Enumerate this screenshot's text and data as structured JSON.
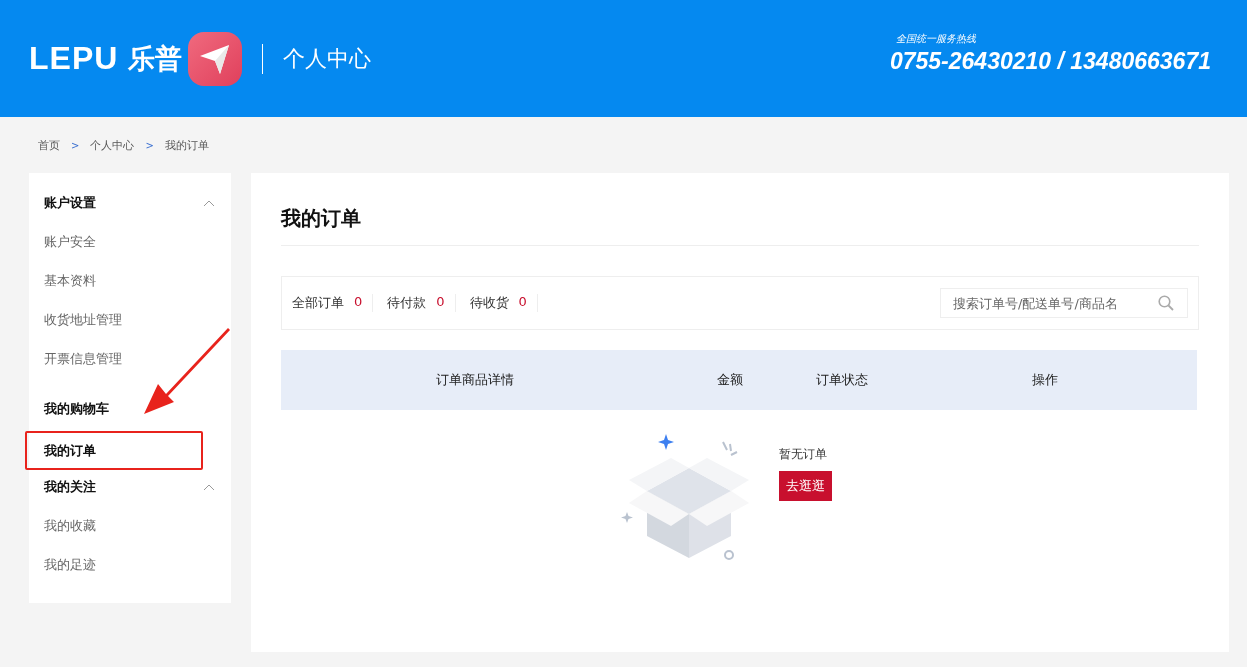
{
  "header": {
    "brand": "LEPU",
    "brand_cn": "乐普",
    "section": "个人中心",
    "hotline_label": "全国统一服务热线",
    "hotline": "0755-26430210 / 13480663671"
  },
  "breadcrumb": [
    "首页",
    "个人中心",
    "我的订单"
  ],
  "breadcrumb_separator": ">",
  "sidebar": [
    {
      "label": "账户设置",
      "kind": "group",
      "expanded": true,
      "highlighted": false,
      "children": [
        {
          "label": "账户安全"
        },
        {
          "label": "基本资料"
        },
        {
          "label": "收货地址管理"
        },
        {
          "label": "开票信息管理"
        }
      ]
    },
    {
      "label": "我的购物车",
      "kind": "link",
      "highlighted": false
    },
    {
      "label": "我的订单",
      "kind": "link",
      "highlighted": true
    },
    {
      "label": "我的关注",
      "kind": "group",
      "expanded": true,
      "highlighted": false,
      "children": [
        {
          "label": "我的收藏"
        },
        {
          "label": "我的足迹"
        }
      ]
    }
  ],
  "main": {
    "title": "我的订单",
    "filters": [
      {
        "label": "全部订单",
        "count": "0"
      },
      {
        "label": "待付款",
        "count": "0"
      },
      {
        "label": "待收货",
        "count": "0"
      }
    ],
    "search": {
      "placeholder": "搜索订单号/配送单号/商品名"
    },
    "table": {
      "columns": [
        "订单商品详情",
        "金额",
        "订单状态",
        "操作"
      ]
    },
    "empty": {
      "message": "暂无订单",
      "button": "去逛逛"
    }
  }
}
